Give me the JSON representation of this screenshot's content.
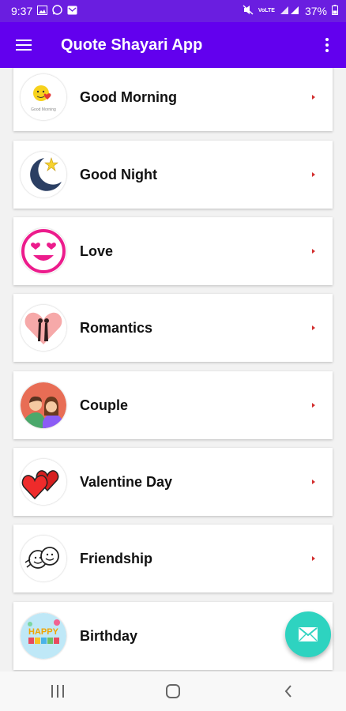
{
  "status_bar": {
    "time": "9:37",
    "left_icons": [
      "image-icon",
      "whatsapp-icon",
      "message-icon"
    ],
    "right_icons": [
      "mute-icon",
      "volte-icon",
      "signal-icon"
    ],
    "volte_text": "VoLTE",
    "battery": "37%"
  },
  "app_bar": {
    "title": "Quote Shayari App",
    "background": "#6200ee"
  },
  "categories": [
    {
      "label": "Good Morning",
      "icon": "good-morning-icon",
      "thumb_caption": "Good Morning"
    },
    {
      "label": "Good Night",
      "icon": "moon-star-icon"
    },
    {
      "label": "Love",
      "icon": "heart-eyes-emoji-icon"
    },
    {
      "label": "Romantics",
      "icon": "couple-heart-icon"
    },
    {
      "label": "Couple",
      "icon": "couple-avatar-icon"
    },
    {
      "label": "Valentine Day",
      "icon": "red-hearts-icon"
    },
    {
      "label": "Friendship",
      "icon": "friends-faces-icon"
    },
    {
      "label": "Birthday",
      "icon": "happy-birthday-icon",
      "thumb_text": "HAPPY"
    }
  ],
  "chevron_color": "#d32f2f",
  "fab": {
    "icon": "email-icon",
    "color": "#2ed3c0"
  },
  "nav_bar": {
    "buttons": [
      "recents-icon",
      "home-icon",
      "back-icon"
    ]
  }
}
